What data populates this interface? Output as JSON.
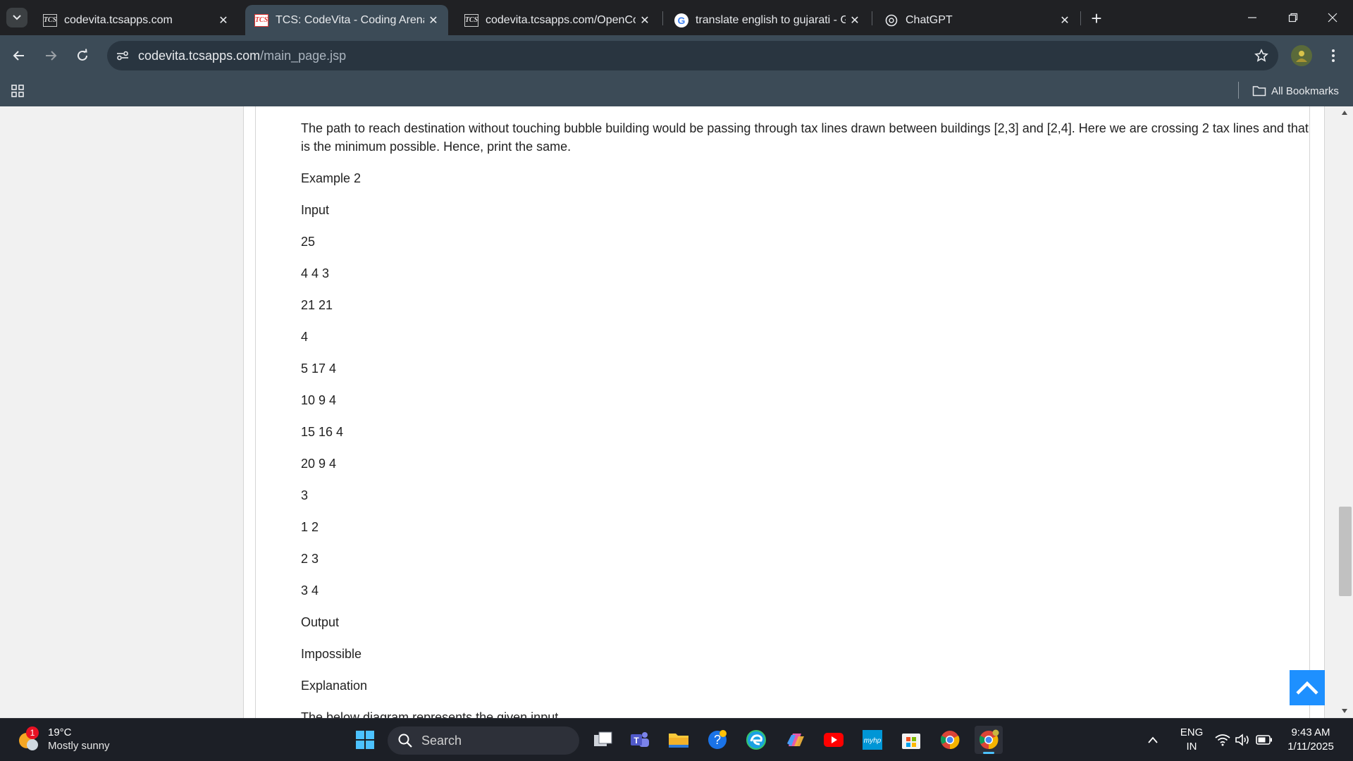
{
  "tabs": [
    {
      "title": "codevita.tcsapps.com",
      "favicon": "TCS",
      "active": false
    },
    {
      "title": "TCS: CodeVita - Coding Arena",
      "favicon": "TCS",
      "active": true
    },
    {
      "title": "codevita.tcsapps.com/OpenCode",
      "favicon": "TCS",
      "active": false
    },
    {
      "title": "translate english to gujarati - Go",
      "favicon": "G",
      "active": false
    },
    {
      "title": "ChatGPT",
      "favicon": "chatgpt-icon",
      "active": false
    }
  ],
  "address": {
    "domain": "codevita.tcsapps.com",
    "path": "/main_page.jsp"
  },
  "bookmarks": {
    "all_label": "All Bookmarks"
  },
  "content": {
    "paragraphs": [
      "The path to reach destination without touching bubble building would be passing through tax lines drawn between buildings [2,3] and [2,4]. Here we are crossing 2 tax lines and that is the minimum possible. Hence, print the same.",
      "Example 2",
      "Input",
      "25",
      "4 4 3",
      "21 21",
      "4",
      "5 17 4",
      "10 9 4",
      "15 16 4",
      "20 9 4",
      "3",
      "1 2",
      "2 3",
      "3 4",
      "Output",
      "Impossible",
      "Explanation",
      "The below diagram represents the given input"
    ]
  },
  "taskbar": {
    "weather": {
      "temp": "19°C",
      "condition": "Mostly sunny",
      "badge": "1"
    },
    "search_placeholder": "Search",
    "lang_line1": "ENG",
    "lang_line2": "IN",
    "time": "9:43 AM",
    "date": "1/11/2025"
  },
  "colors": {
    "accent": "#1e90ff",
    "tab_active": "#3c4b57",
    "tabstrip": "#202124"
  }
}
